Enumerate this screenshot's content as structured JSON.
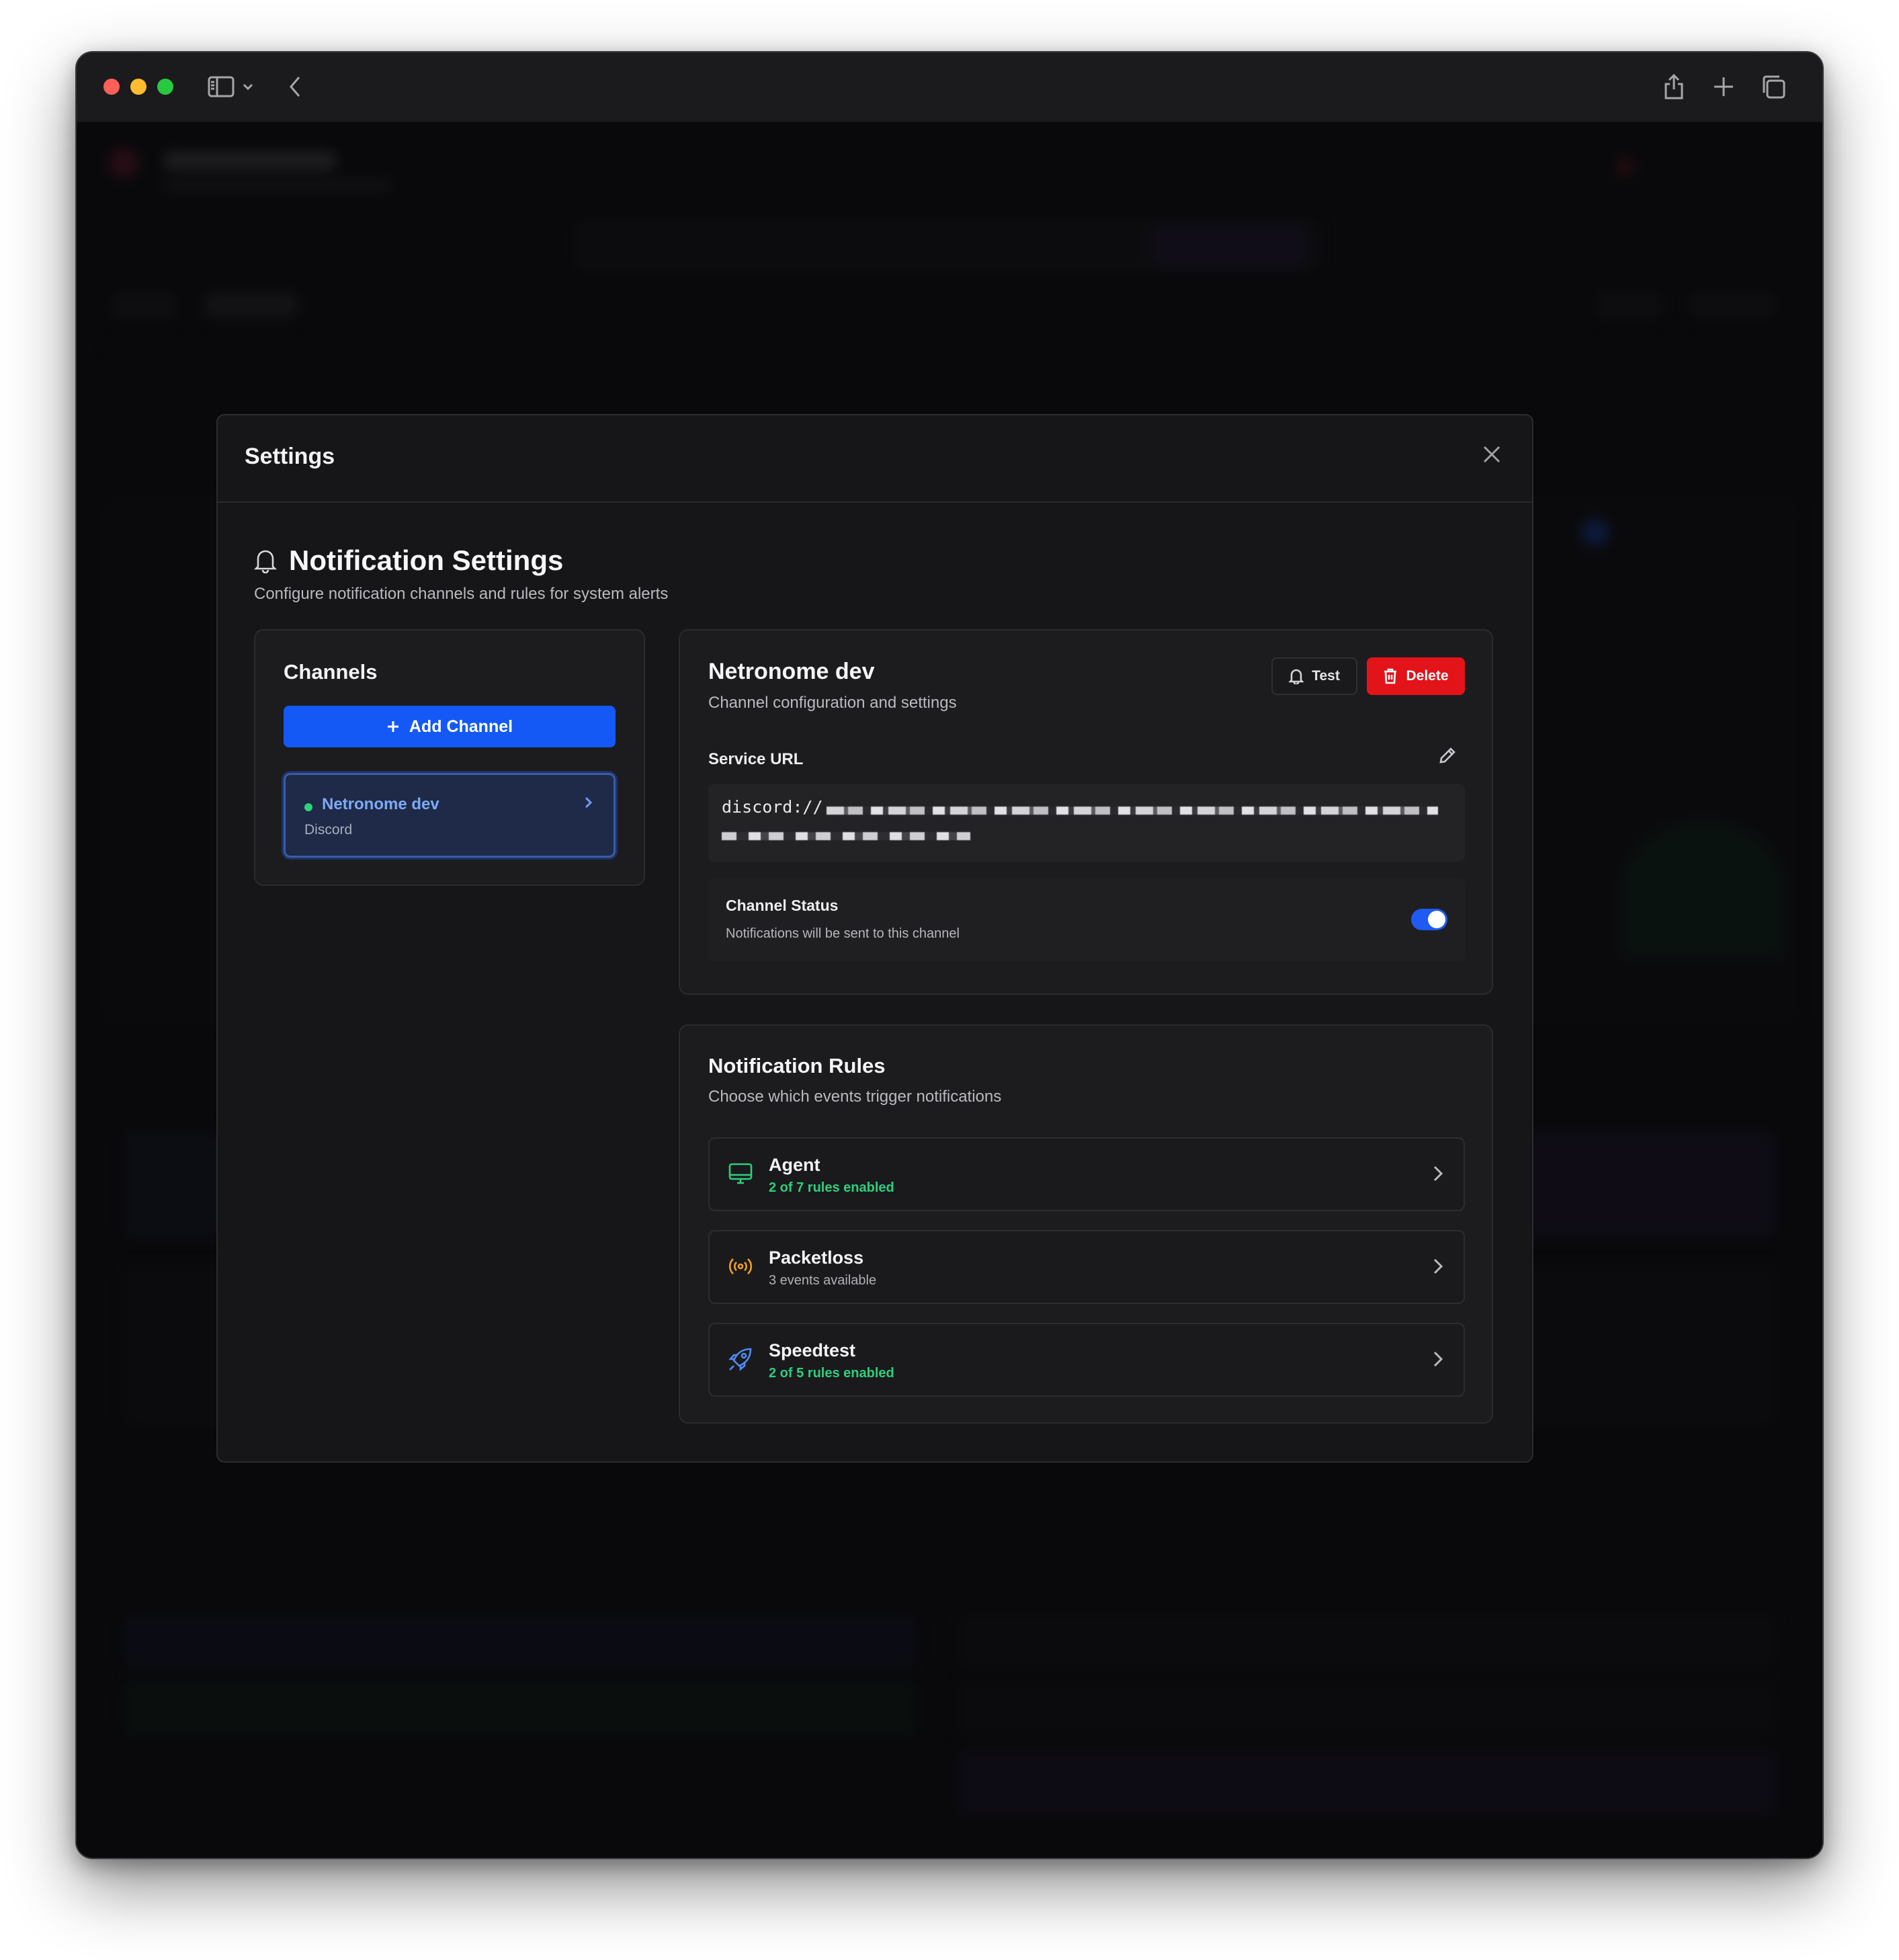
{
  "modal": {
    "title": "Settings"
  },
  "notification_settings": {
    "title": "Notification Settings",
    "subtitle": "Configure notification channels and rules for system alerts"
  },
  "channels": {
    "title": "Channels",
    "add_label": "Add Channel",
    "items": [
      {
        "name": "Netronome dev",
        "type": "Discord",
        "status_color": "#2fd27c",
        "selected": true
      }
    ]
  },
  "channel_config": {
    "title": "Netronome dev",
    "subtitle": "Channel configuration and settings",
    "test_label": "Test",
    "delete_label": "Delete",
    "service_url_label": "Service URL",
    "service_url_value": "discord://",
    "status_title": "Channel Status",
    "status_subtitle": "Notifications will be sent to this channel",
    "status_enabled": true
  },
  "rules": {
    "title": "Notification Rules",
    "subtitle": "Choose which events trigger notifications",
    "items": [
      {
        "name": "Agent",
        "meta": "2 of 7 rules enabled",
        "icon": "monitor-icon",
        "color": "#2ecf7c"
      },
      {
        "name": "Packetloss",
        "meta": "3 events available",
        "icon": "broadcast-icon",
        "color": "#f0a020"
      },
      {
        "name": "Speedtest",
        "meta": "2 of 5 rules enabled",
        "icon": "rocket-icon",
        "color": "#4f8cf5"
      }
    ]
  },
  "colors": {
    "accent": "#1459f5",
    "danger": "#e3131a",
    "success": "#2ecf7c"
  }
}
